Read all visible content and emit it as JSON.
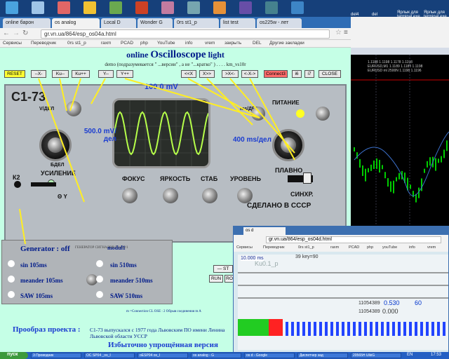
{
  "desktop": {
    "icons": [
      {
        "label": "",
        "color": "#4aa3df",
        "icon": "app-icon"
      },
      {
        "label": "",
        "color": "#9fc5e8",
        "icon": "save-icon"
      },
      {
        "label": "",
        "color": "#e06666",
        "icon": "app-icon"
      },
      {
        "label": "",
        "color": "#f1c232",
        "icon": "chrome-icon"
      },
      {
        "label": "",
        "color": "#6aa84f",
        "icon": "app-icon"
      },
      {
        "label": "",
        "color": "#cc4125",
        "icon": "app-icon"
      },
      {
        "label": "",
        "color": "#c27ba0",
        "icon": "app-icon"
      },
      {
        "label": "",
        "color": "#76a5af",
        "icon": "app-icon"
      },
      {
        "label": "",
        "color": "#e69138",
        "icon": "app-icon"
      },
      {
        "label": "",
        "color": "#674ea7",
        "icon": "app-icon"
      },
      {
        "label": "",
        "color": "#45818e",
        "icon": "app-icon"
      },
      {
        "label": "",
        "color": "#3d85c6",
        "icon": "app-icon"
      }
    ],
    "right_labels": [
      "del4",
      "del",
      "Ярлык для terminal.exe",
      "Ярлык для terminal.exe"
    ]
  },
  "browser": {
    "tabs": [
      "online барон",
      "os analog",
      "Local D",
      "Wonder G",
      "0rs st1_p",
      "list test",
      "os225w - лет"
    ],
    "active_tab": 1,
    "url": "gr.vn.ua/864/esp_os04a.html",
    "bookmarks": [
      "Сервисы",
      "Переводчик",
      "0rs st1_p",
      "raxm",
      "PCAD",
      "php",
      "YouTube",
      "info",
      "vrem",
      "закрыть",
      "DEL",
      "Другие закладки"
    ]
  },
  "page": {
    "title_prefix": "online ",
    "title_main": "Oscilloscope",
    "title_suffix": " light",
    "subtitle": "demo (подразумевается \" ...версии\" , а не \"...кратко\" ) . . . . km_vs10r",
    "buttons": {
      "reset": "RESET",
      "x_minus": "--X-",
      "ku_minus": "Ku--",
      "ku_plus": "Ku++",
      "y_minus": "Y--",
      "y_plus": "Y++",
      "left_x": "<<X",
      "x_right": "X>>",
      "xx_left": ">X<-",
      "xx_right": "<-X->",
      "connect": "Connect3",
      "n1": "i6",
      "n2": "i7",
      "close": "CLOSE"
    },
    "voltage": "100.0 mV",
    "volts_per_div": "500.0 mV/дел",
    "time_per_div": "400 ms/дел",
    "model": "С1-73",
    "panel_labels": {
      "vdel": "V/ДЕЛ",
      "usilenie": "УСИЛЕНИЕ",
      "bdel": "БДЕЛ",
      "fokus": "ФОКУС",
      "yarkost": "ЯРКОСТЬ",
      "stab": "СТАБ",
      "uroven": "УРОВЕНЬ",
      "pitanie": "ПИТАНИЕ",
      "plavno": "ПЛАВНО",
      "sinhr": "СИНХР.",
      "made": "СДЕЛАНО В СССР",
      "msdel": "ms/ДЕЛ",
      "k2": "К2",
      "theta_y": "Θ Y"
    },
    "generator": {
      "title": "Generator : off",
      "module": "modul1",
      "sin105": "sin 105ms",
      "sin510": "sin 510ms",
      "meander105": "meander 105ms",
      "meander510": "meander 510ms",
      "saw105": "SAW 105ms",
      "saw510": "SAW 510ms",
      "device": "ГЕНЕРАТОР СИГНАЛОВ ГЗ-112/1"
    },
    "small_text": "m =Connection CL OSE : 2 Обрыв соединения m A",
    "prototype_label": "Прообраз проекта :",
    "prototype_text": "C1-73 выпускался с 1977 года Львовским ПО имени Ленина Львовской области УССР",
    "simplified": "Избыточно упрощённая версия",
    "side_buttons": [
      "— ST",
      "RUN",
      "RO"
    ]
  },
  "chart": {
    "header_lines": [
      "1.1188 1.1198 1.1178 1.1198",
      "EURUSD,M1 1.1189 1.1188 1.1198",
      "EURUSD  ml 2500N  1.1198 1.1196"
    ],
    "candle_color": "#00cc00"
  },
  "window2": {
    "tab": "os d",
    "url": "gr.vn.ua/864/esp_os04d.html",
    "bookmarks": [
      "Сервисы",
      "Переводчик",
      "0rs st1_p",
      "raxm",
      "PCAD",
      "php",
      "youTube",
      "info",
      "vrem"
    ],
    "time_label": "10.000 ms",
    "key_label": "39 key=90",
    "ku_label": "Ku0.1_p",
    "val1": "11054389",
    "val2": "0.530",
    "val3": "60",
    "val4": "11054389",
    "val5": "0.000"
  },
  "taskbar": {
    "start": "пуск",
    "items": [
      "3 Проводник",
      "ОС SP04 _os_I",
      "oESP04 os_I",
      "os analog - G",
      "os d - Google",
      "Диспетчер зад",
      "20565H UlkiG"
    ],
    "lang": "EN",
    "time": "17:53"
  }
}
